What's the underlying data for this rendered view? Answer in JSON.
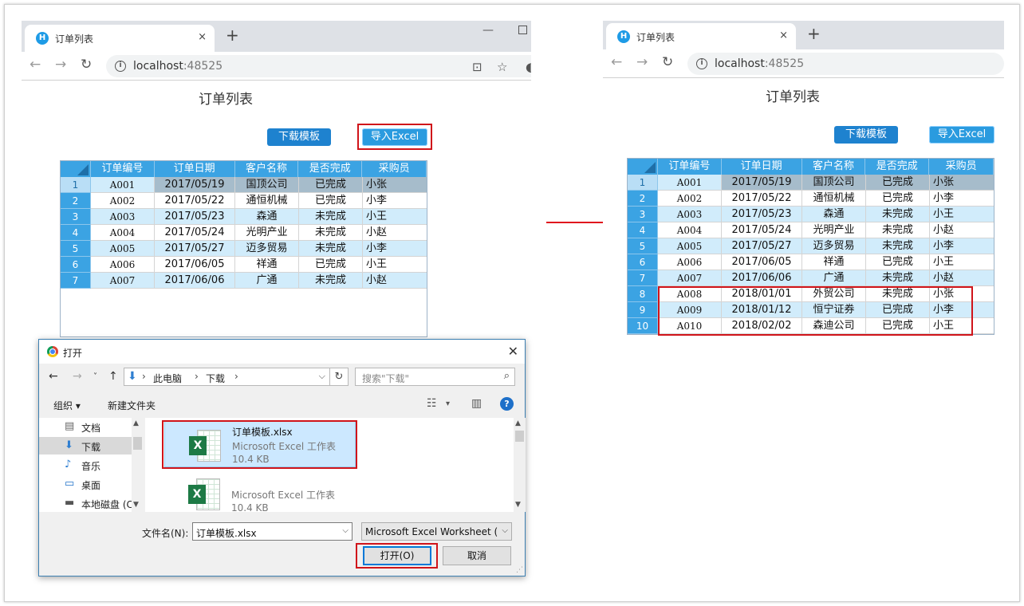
{
  "browser": {
    "tab_title": "订单列表",
    "tab_close": "×",
    "new_tab": "+",
    "url_host": "localhost",
    "url_port": ":48525"
  },
  "page": {
    "title": "订单列表",
    "download_button": "下载模板",
    "import_button": "导入Excel"
  },
  "table": {
    "headers": [
      "订单编号",
      "订单日期",
      "客户名称",
      "是否完成",
      "采购员"
    ],
    "rows_before": [
      [
        "1",
        "A001",
        "2017/05/19",
        "国顶公司",
        "已完成",
        "小张"
      ],
      [
        "2",
        "A002",
        "2017/05/22",
        "通恒机械",
        "已完成",
        "小李"
      ],
      [
        "3",
        "A003",
        "2017/05/23",
        "森通",
        "未完成",
        "小王"
      ],
      [
        "4",
        "A004",
        "2017/05/24",
        "光明产业",
        "未完成",
        "小赵"
      ],
      [
        "5",
        "A005",
        "2017/05/27",
        "迈多贸易",
        "未完成",
        "小李"
      ],
      [
        "6",
        "A006",
        "2017/06/05",
        "祥通",
        "已完成",
        "小王"
      ],
      [
        "7",
        "A007",
        "2017/06/06",
        "广通",
        "未完成",
        "小赵"
      ]
    ],
    "rows_after": [
      [
        "1",
        "A001",
        "2017/05/19",
        "国顶公司",
        "已完成",
        "小张"
      ],
      [
        "2",
        "A002",
        "2017/05/22",
        "通恒机械",
        "已完成",
        "小李"
      ],
      [
        "3",
        "A003",
        "2017/05/23",
        "森通",
        "未完成",
        "小王"
      ],
      [
        "4",
        "A004",
        "2017/05/24",
        "光明产业",
        "未完成",
        "小赵"
      ],
      [
        "5",
        "A005",
        "2017/05/27",
        "迈多贸易",
        "未完成",
        "小李"
      ],
      [
        "6",
        "A006",
        "2017/06/05",
        "祥通",
        "已完成",
        "小王"
      ],
      [
        "7",
        "A007",
        "2017/06/06",
        "广通",
        "未完成",
        "小赵"
      ],
      [
        "8",
        "A008",
        "2018/01/01",
        "外贸公司",
        "未完成",
        "小张"
      ],
      [
        "9",
        "A009",
        "2018/01/12",
        "恒宁证券",
        "已完成",
        "小李"
      ],
      [
        "10",
        "A010",
        "2018/02/02",
        "森迪公司",
        "已完成",
        "小王"
      ]
    ]
  },
  "dialog": {
    "title": "打开",
    "close": "✕",
    "breadcrumb": [
      "此电脑",
      "下载"
    ],
    "search_placeholder": "搜索\"下载\"",
    "organize": "组织 ▾",
    "new_folder": "新建文件夹",
    "nav_items": [
      {
        "label": "文档",
        "icon": "document-icon"
      },
      {
        "label": "下载",
        "icon": "download-icon"
      },
      {
        "label": "音乐",
        "icon": "music-icon"
      },
      {
        "label": "桌面",
        "icon": "desktop-icon"
      },
      {
        "label": "本地磁盘 (C",
        "icon": "disk-icon"
      }
    ],
    "files": [
      {
        "name": "订单模板.xlsx",
        "type": "Microsoft Excel 工作表",
        "size": "10.4 KB"
      },
      {
        "name": "",
        "type": "Microsoft Excel 工作表",
        "size": "10.4 KB"
      }
    ],
    "filename_label": "文件名(N):",
    "filename_value": "订单模板.xlsx",
    "filter_value": "Microsoft Excel Worksheet (",
    "open_button": "打开(O)",
    "cancel_button": "取消"
  },
  "colors": {
    "highlight": "#d0141a",
    "grid_header": "#3ba3e3",
    "grid_alt_row": "#d1ecfb",
    "button": "#1e82cf"
  }
}
